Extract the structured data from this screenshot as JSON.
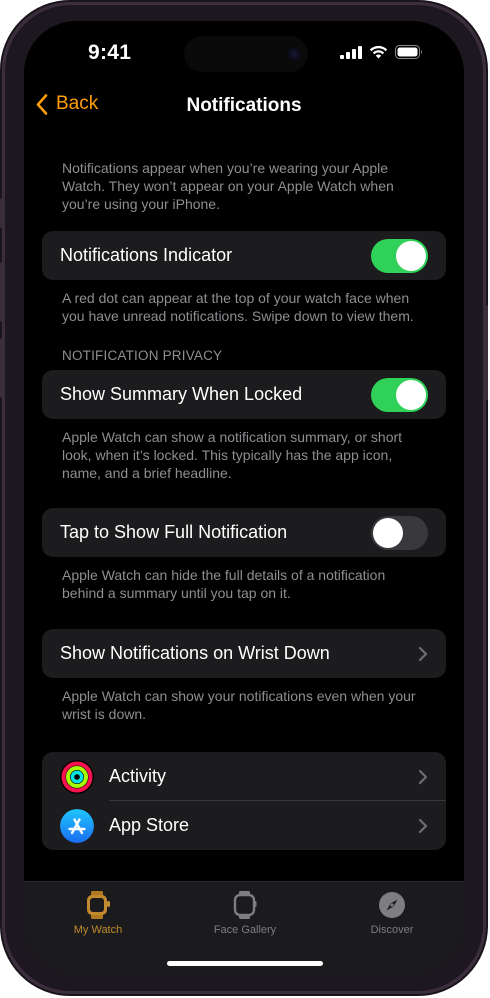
{
  "status": {
    "time": "9:41"
  },
  "nav": {
    "back": "Back",
    "title": "Notifications"
  },
  "intro": "Notifications appear when you’re wearing your Apple Watch. They won’t appear on your Apple Watch when you’re using your iPhone.",
  "indicator": {
    "label": "Notifications Indicator",
    "enabled": true,
    "footer": "A red dot can appear at the top of your watch face when you have unread notifications. Swipe down to view them."
  },
  "privacy_header": "NOTIFICATION PRIVACY",
  "summary": {
    "label": "Show Summary When Locked",
    "enabled": true,
    "footer": "Apple Watch can show a notification summary, or short look, when it’s locked. This typically has the app icon, name, and a brief headline."
  },
  "tap_full": {
    "label": "Tap to Show Full Notification",
    "enabled": false,
    "footer": "Apple Watch can hide the full details of a notification behind a summary until you tap on it."
  },
  "wrist_down": {
    "label": "Show Notifications on Wrist Down",
    "footer": "Apple Watch can show your notifications even when your wrist is down."
  },
  "apps": [
    {
      "label": "Activity",
      "icon": "activity-rings-icon"
    },
    {
      "label": "App Store",
      "icon": "app-store-icon"
    }
  ],
  "tabs": [
    {
      "label": "My Watch",
      "icon": "watch-icon",
      "active": true
    },
    {
      "label": "Face Gallery",
      "icon": "watch-face-icon",
      "active": false
    },
    {
      "label": "Discover",
      "icon": "compass-icon",
      "active": false
    }
  ],
  "colors": {
    "accent": "#ff9f0a",
    "toggle_on": "#30d158",
    "active_tab": "#c18a2e"
  }
}
